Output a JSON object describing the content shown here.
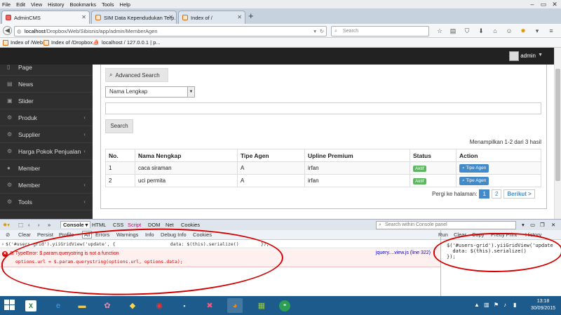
{
  "menubar": [
    "File",
    "Edit",
    "View",
    "History",
    "Bookmarks",
    "Tools",
    "Help"
  ],
  "tabs": [
    {
      "label": "AdminCMS",
      "active": true
    },
    {
      "label": "SIM Data Kependudukan Terp...",
      "active": false
    },
    {
      "label": "Index of /",
      "active": false
    }
  ],
  "nav": {
    "url_host": "localhost",
    "url_path": "/Dropbox/Web/Sibisnis/app/admin/MemberAgen",
    "search_placeholder": "Search"
  },
  "bookmarks": [
    "Index of /Web",
    "Index of /Dropbox",
    "localhost / 127.0.0.1 | p..."
  ],
  "header": {
    "username": "admin"
  },
  "sidebar": {
    "items": [
      {
        "label": "Page",
        "icon": "file-icon",
        "chevron": false
      },
      {
        "label": "News",
        "icon": "news-icon",
        "chevron": false
      },
      {
        "label": "Slider",
        "icon": "image-icon",
        "chevron": false
      },
      {
        "label": "Produk",
        "icon": "cogs-icon",
        "chevron": true
      },
      {
        "label": "Supplier",
        "icon": "cogs-icon",
        "chevron": true
      },
      {
        "label": "Harga Pokok Penjualan",
        "icon": "cogs-icon",
        "chevron": true
      },
      {
        "label": "Member",
        "icon": "user-icon",
        "chevron": false
      },
      {
        "label": "Member",
        "icon": "cogs-icon",
        "chevron": true
      },
      {
        "label": "Tools",
        "icon": "cogs-icon",
        "chevron": true
      }
    ]
  },
  "main": {
    "advanced_search_label": "Advanced Search",
    "select_value": "Nama Lengkap",
    "search_button": "Search",
    "summary": "Menampilkan 1-2 dari 3 hasil",
    "columns": [
      "No.",
      "Nama Nengkap",
      "Tipe Agen",
      "Upline Premium",
      "Status",
      "Action"
    ],
    "rows": [
      {
        "no": "1",
        "nama": "caca siraman",
        "tipe": "A",
        "upline": "irfan",
        "status": "Aktif",
        "action": "Tipe Agen"
      },
      {
        "no": "2",
        "nama": "uci permita",
        "tipe": "A",
        "upline": "irfan",
        "status": "Aktif",
        "action": "Tipe Agen"
      }
    ],
    "pager": {
      "label": "Pergi ke halaman:",
      "pages": [
        "1",
        "2"
      ],
      "next": "Berikut >"
    }
  },
  "firebug": {
    "tabs": [
      "Console",
      "HTML",
      "CSS",
      "Script",
      "DOM",
      "Net",
      "Cookies"
    ],
    "search_placeholder": "Search within Console panel",
    "filters": [
      "Clear",
      "Persist",
      "Profile",
      "All",
      "Errors",
      "Warnings",
      "Info",
      "Debug Info",
      "Cookies"
    ],
    "command_line": "$('#users-grid').yiiGridView('update', {                    data: $(this).serialize()        });",
    "error_message": "TypeError: $.param.querystring is not a function",
    "error_source": "options.url = $.param.querystring(options.url, options.data);",
    "error_link": "jquery....view.js (line 322)",
    "cmd_toolbar": [
      "Run",
      "Clear",
      "Copy",
      "Pretty Print",
      "History"
    ],
    "cmd_code_1": "$('#users-grid').yiiGridView('update",
    "cmd_code_2": "  data: $(this).serialize()",
    "cmd_code_3": "});"
  },
  "taskbar": {
    "time": "13:18",
    "date": "30/09/2015"
  }
}
